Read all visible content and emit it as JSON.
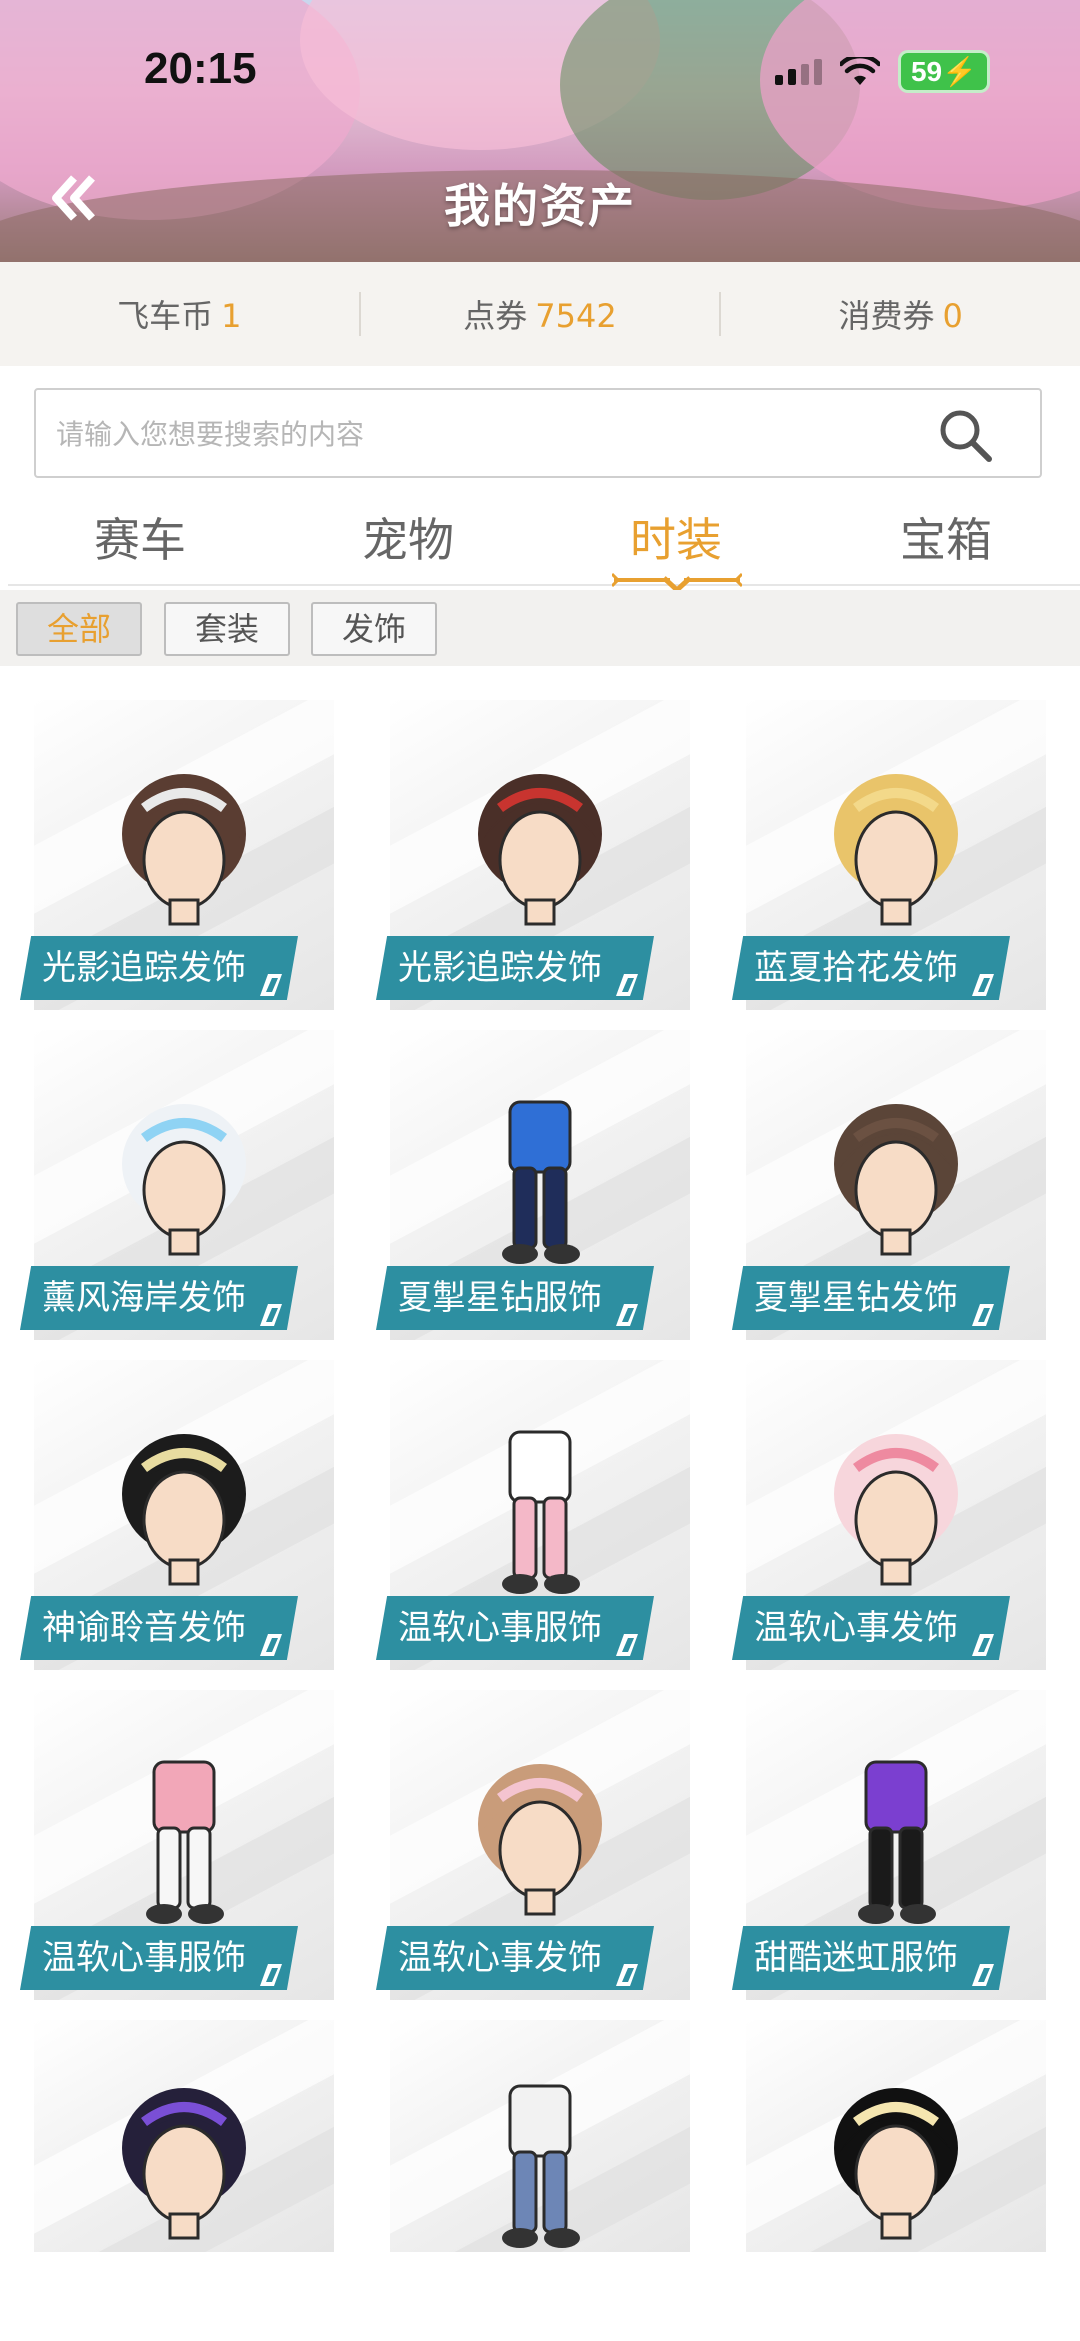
{
  "status_bar": {
    "time": "20:15",
    "battery": "59"
  },
  "header": {
    "title": "我的资产"
  },
  "currency": [
    {
      "label": "飞车币",
      "value": "1"
    },
    {
      "label": "点券",
      "value": "7542"
    },
    {
      "label": "消费券",
      "value": "0"
    }
  ],
  "search": {
    "placeholder": "请输入您想要搜索的内容"
  },
  "tabs": [
    {
      "label": "赛车",
      "active": false
    },
    {
      "label": "宠物",
      "active": false
    },
    {
      "label": "时装",
      "active": true
    },
    {
      "label": "宝箱",
      "active": false
    }
  ],
  "filters": [
    {
      "label": "全部",
      "active": true
    },
    {
      "label": "套装",
      "active": false
    },
    {
      "label": "发饰",
      "active": false
    }
  ],
  "items": [
    {
      "name": "光影追踪发饰",
      "kind": "hair",
      "hair_color": "#5a3d32",
      "accent": "#e9e9e9"
    },
    {
      "name": "光影追踪发饰",
      "kind": "hair",
      "hair_color": "#4a2f28",
      "accent": "#c8342f"
    },
    {
      "name": "蓝夏拾花发饰",
      "kind": "hair",
      "hair_color": "#e9c46a",
      "accent": "#f3d98a"
    },
    {
      "name": "薰风海岸发饰",
      "kind": "hair",
      "hair_color": "#eef2f6",
      "accent": "#8fd3f4"
    },
    {
      "name": "夏掣星钻服饰",
      "kind": "outfit",
      "hair_color": "#1f2d5a",
      "accent": "#2f6fd6"
    },
    {
      "name": "夏掣星钻发饰",
      "kind": "hair",
      "hair_color": "#5b4538",
      "accent": "#6b5142"
    },
    {
      "name": "神谕聆音发饰",
      "kind": "hair",
      "hair_color": "#1c1c1c",
      "accent": "#e8dca0"
    },
    {
      "name": "温软心事服饰",
      "kind": "outfit",
      "hair_color": "#f4b8c8",
      "accent": "#ffffff"
    },
    {
      "name": "温软心事发饰",
      "kind": "hair",
      "hair_color": "#f7d6dc",
      "accent": "#ee8aa0"
    },
    {
      "name": "温软心事服饰",
      "kind": "outfit",
      "hair_color": "#f7f7f7",
      "accent": "#f2a7b8"
    },
    {
      "name": "温软心事发饰",
      "kind": "hair",
      "hair_color": "#c99c7a",
      "accent": "#f4c4d0"
    },
    {
      "name": "甜酷迷虹服饰",
      "kind": "outfit",
      "hair_color": "#1a1a1a",
      "accent": "#7b3fd0"
    },
    {
      "name": "",
      "kind": "hair",
      "hair_color": "#25203a",
      "accent": "#7a4fd6"
    },
    {
      "name": "",
      "kind": "outfit",
      "hair_color": "#6d86b6",
      "accent": "#f2f2f2"
    },
    {
      "name": "",
      "kind": "hair",
      "hair_color": "#111111",
      "accent": "#f5e6b0"
    }
  ]
}
